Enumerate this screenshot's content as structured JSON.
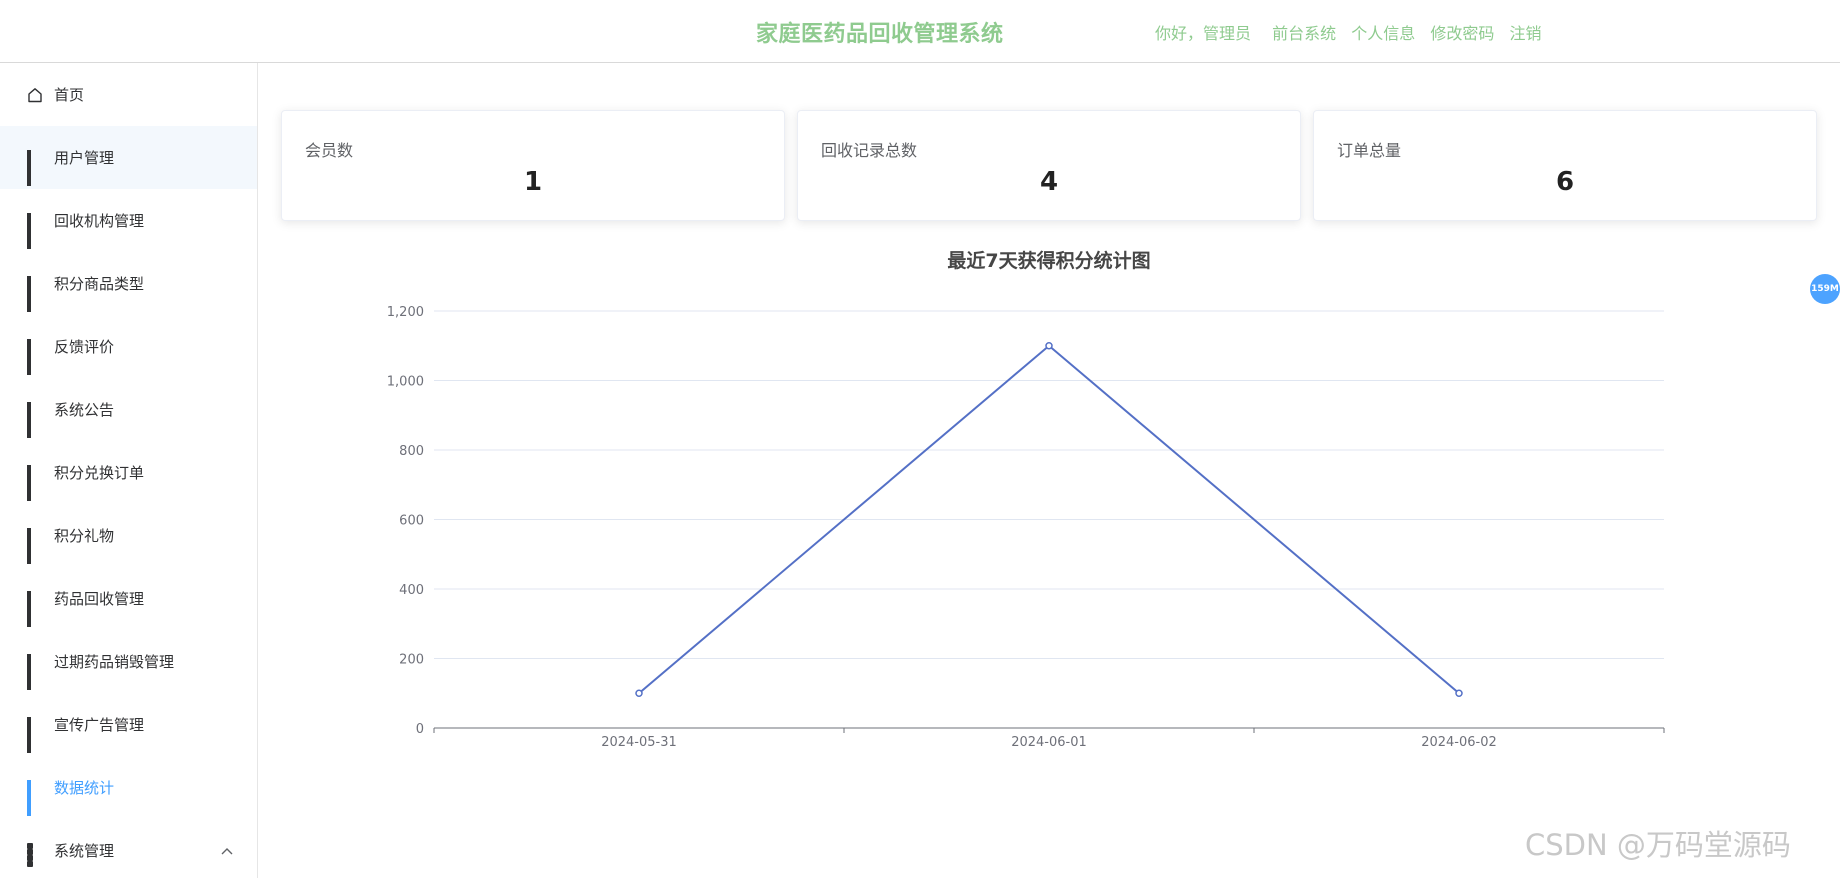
{
  "header": {
    "title": "家庭医药品回收管理系统",
    "greeting": "你好，管理员",
    "links": [
      "前台系统",
      "个人信息",
      "修改密码",
      "注销"
    ]
  },
  "sidebar": {
    "items": [
      {
        "label": "首页",
        "icon": "home-icon"
      },
      {
        "label": "用户管理",
        "icon": "grid-icon"
      },
      {
        "label": "回收机构管理",
        "icon": "grid-icon"
      },
      {
        "label": "积分商品类型",
        "icon": "grid-icon"
      },
      {
        "label": "反馈评价",
        "icon": "grid-icon"
      },
      {
        "label": "系统公告",
        "icon": "grid-icon"
      },
      {
        "label": "积分兑换订单",
        "icon": "grid-icon"
      },
      {
        "label": "积分礼物",
        "icon": "grid-icon"
      },
      {
        "label": "药品回收管理",
        "icon": "grid-icon"
      },
      {
        "label": "过期药品销毁管理",
        "icon": "grid-icon"
      },
      {
        "label": "宣传广告管理",
        "icon": "grid-icon"
      },
      {
        "label": "数据统计",
        "icon": "grid-icon",
        "active": true
      },
      {
        "label": "系统管理",
        "icon": "apps-icon",
        "arrow": "chevron-up-icon"
      }
    ]
  },
  "stats": [
    {
      "label": "会员数",
      "value": "1"
    },
    {
      "label": "回收记录总数",
      "value": "4"
    },
    {
      "label": "订单总量",
      "value": "6"
    }
  ],
  "chart_data": {
    "type": "line",
    "title": "最近7天获得积分统计图",
    "categories": [
      "2024-05-31",
      "2024-06-01",
      "2024-06-02"
    ],
    "series": [
      {
        "values": [
          100,
          1100,
          100
        ],
        "color": "#5470c6"
      }
    ],
    "ylim": [
      0,
      1200
    ],
    "yticks": [
      "0",
      "200",
      "400",
      "600",
      "800",
      "1,000",
      "1,200"
    ],
    "grid": true
  },
  "badge": "159M",
  "watermark": "CSDN @万码堂源码",
  "colors": {
    "title": "#8fcb8f",
    "active": "#409eff",
    "line": "#5470c6"
  }
}
